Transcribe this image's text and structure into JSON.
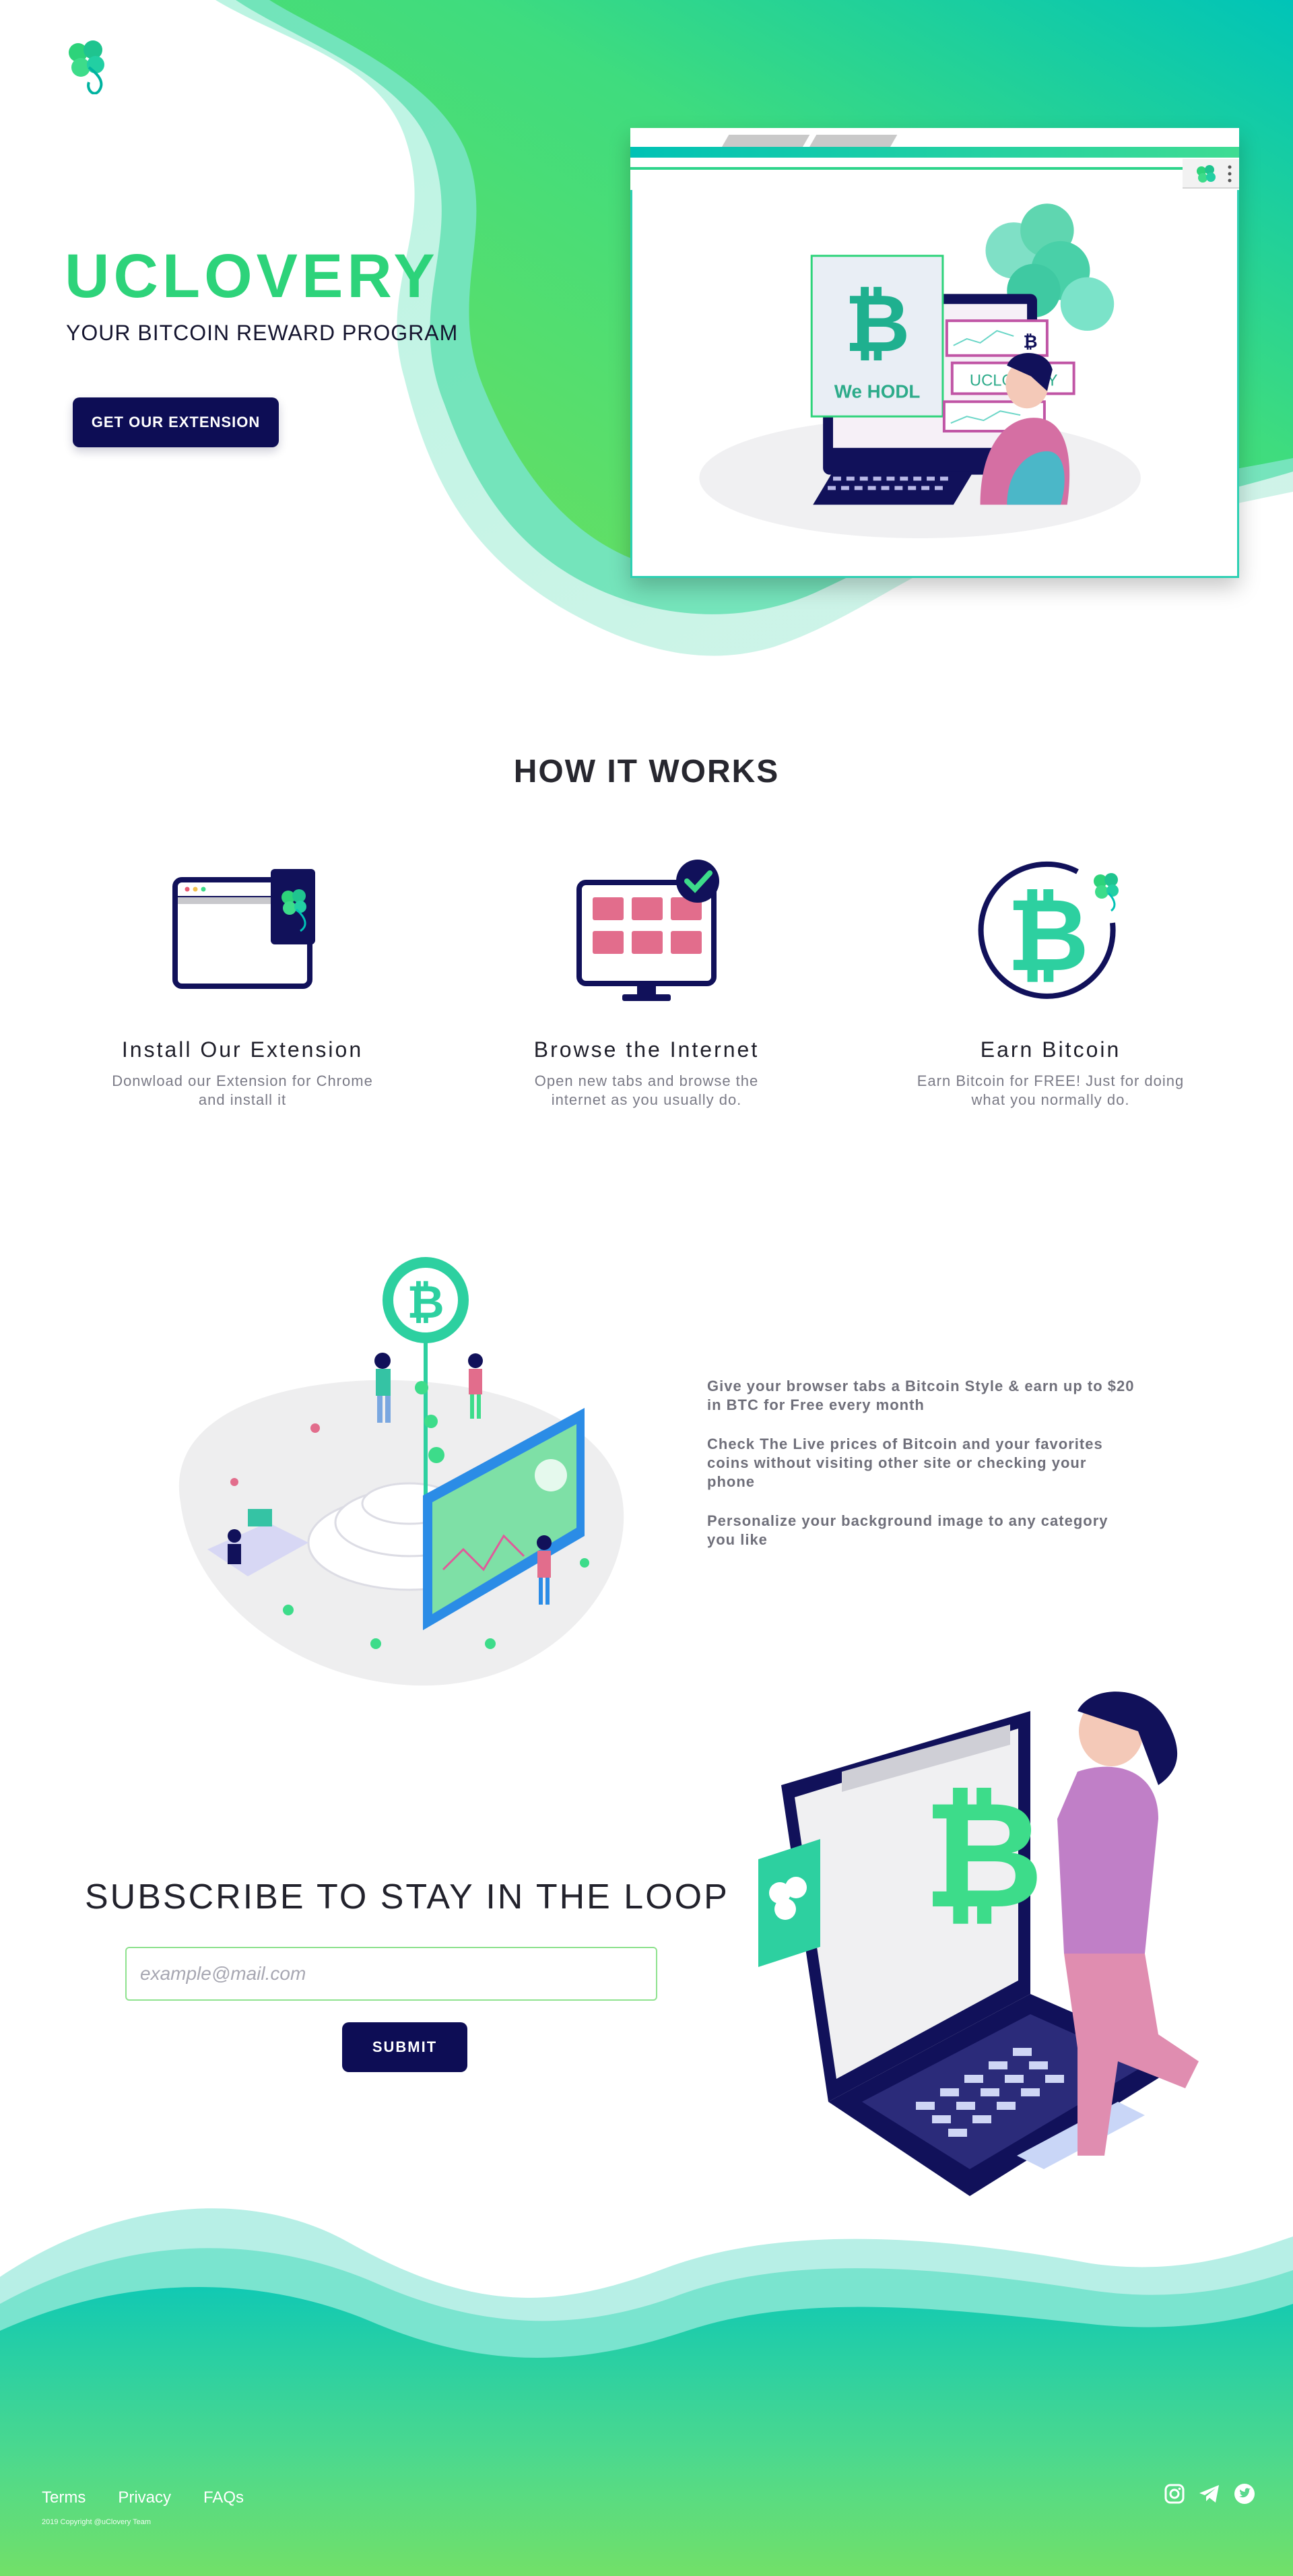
{
  "hero": {
    "title": "UCLOVERY",
    "subtitle": "YOUR BITCOIN REWARD PROGRAM",
    "cta_label": "GET OUR EXTENSION",
    "illustration_sign": "We HODL",
    "illustration_banner": "UCLOVERY"
  },
  "how_it_works": {
    "title": "HOW IT WORKS",
    "steps": [
      {
        "title": "Install Our Extension",
        "desc": "Donwload our Extension for Chrome and install it"
      },
      {
        "title": "Browse the Internet",
        "desc": "Open new tabs and browse the internet as you usually do."
      },
      {
        "title": "Earn Bitcoin",
        "desc": "Earn Bitcoin for FREE! Just for doing what you normally do."
      }
    ]
  },
  "features": {
    "items": [
      "Give your browser tabs a Bitcoin Style & earn up to $20 in BTC for Free every month",
      "Check The Live prices of Bitcoin and your favorites coins without visiting other site or checking your phone",
      "Personalize your background image to any category you like"
    ]
  },
  "subscribe": {
    "title": "SUBSCRIBE TO STAY IN THE LOOP",
    "email_placeholder": "example@mail.com",
    "submit_label": "SUBMIT"
  },
  "footer": {
    "links": [
      "Terms",
      "Privacy",
      "FAQs"
    ],
    "copyright": "2019 Copyright @uClovery Team",
    "social_icons": [
      "instagram-icon",
      "telegram-icon",
      "twitter-icon"
    ]
  },
  "colors": {
    "brand_green": "#2dd37a",
    "navy": "#0d0d55",
    "teal": "#00c2b5",
    "light_green": "#6ee26a"
  }
}
